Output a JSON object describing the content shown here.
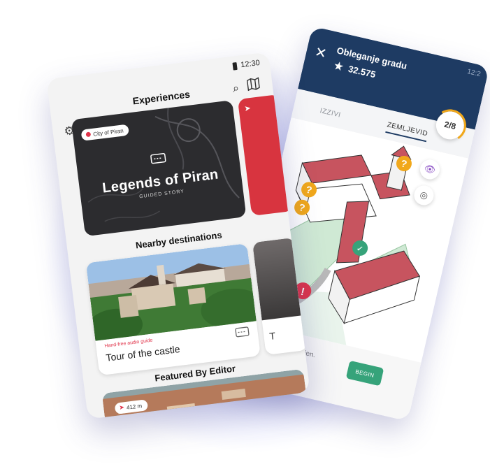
{
  "back_phone": {
    "title": "Obleganje gradu",
    "score": "32.575",
    "status_time": "12:2",
    "tabs": [
      "IZZIVI",
      "ZEMLJEVID"
    ],
    "progress": "2/8",
    "progress_fraction": 0.25,
    "description": "Poskrbi ... pripravljen.",
    "begin_label": "BEGIN",
    "colors": {
      "header": "#1e3b63",
      "accent": "#f1a81b",
      "begin": "#36a37a",
      "roof": "#c7545f"
    }
  },
  "front_phone": {
    "status_time": "12:30",
    "title": "Experiences",
    "hero": {
      "location": "City of Piran",
      "title": "Legends of Piran",
      "subtitle": "GUIDED STORY"
    },
    "sections": {
      "nearby": "Nearby destinations",
      "featured": "Featured By Editor"
    },
    "castle_card": {
      "tag": "Hand-free audio guide",
      "title": "Tour of the castle"
    },
    "side_card_text": "T",
    "distance": "412 m",
    "colors": {
      "accent": "#e0344a",
      "hero_bg": "#2c2c2f",
      "red_card": "#d8343f"
    }
  }
}
